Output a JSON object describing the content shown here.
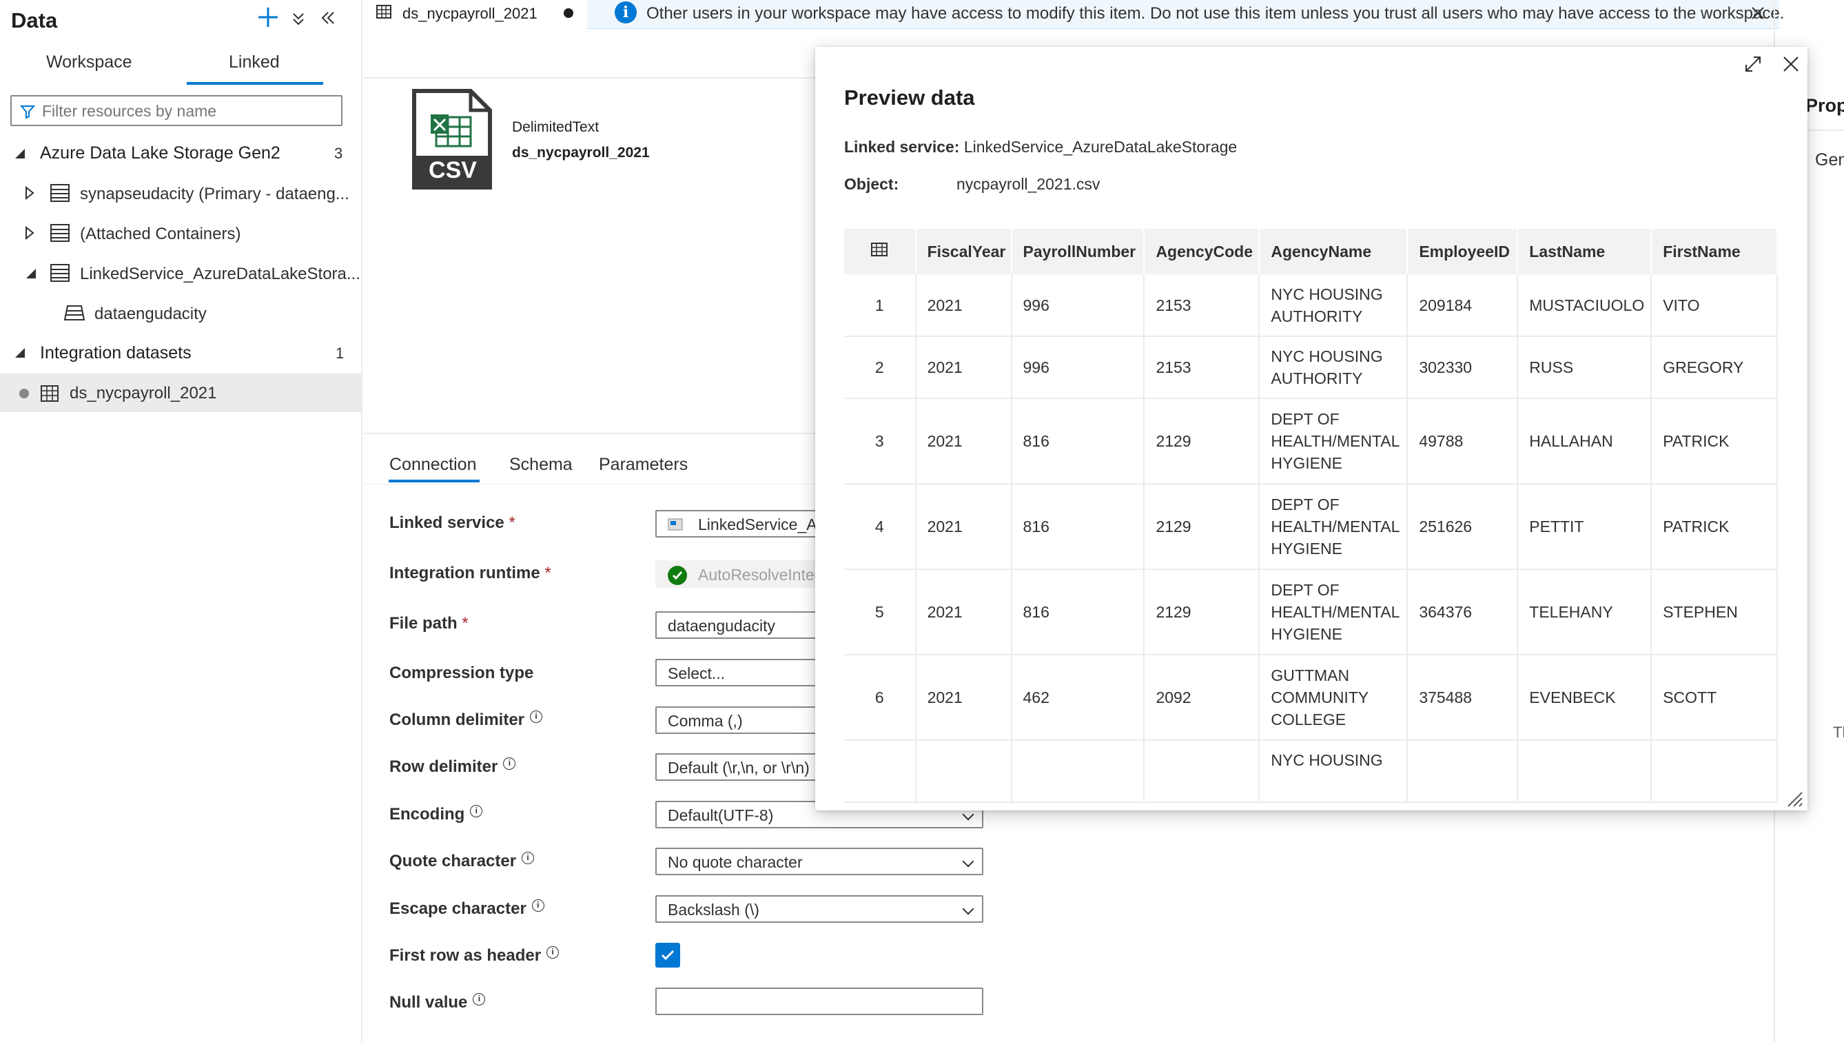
{
  "left_panel": {
    "title": "Data",
    "tabs": [
      "Workspace",
      "Linked"
    ],
    "filter_placeholder": "Filter resources by name",
    "sections": [
      {
        "label": "Azure Data Lake Storage Gen2",
        "count": "3",
        "items": [
          {
            "label": "synapseudacity (Primary - dataeng..."
          },
          {
            "label": "(Attached Containers)"
          },
          {
            "label": "LinkedService_AzureDataLakeStora...",
            "children": [
              {
                "label": "dataengudacity"
              }
            ]
          }
        ]
      },
      {
        "label": "Integration datasets",
        "count": "1",
        "items": [
          {
            "label": "ds_nycpayroll_2021"
          }
        ]
      }
    ]
  },
  "doc_tab": {
    "title": "ds_nycpayroll_2021"
  },
  "banner": {
    "text": "Other users in your workspace may have access to modify this item. Do not use this item unless you trust all users who may have access to the workspace."
  },
  "dataset": {
    "type": "DelimitedText",
    "name": "ds_nycpayroll_2021",
    "icon_label": "CSV"
  },
  "config_tabs": [
    "Connection",
    "Schema",
    "Parameters"
  ],
  "fields": {
    "linked_service": {
      "label": "Linked service",
      "value": "LinkedService_Az"
    },
    "integration_runtime": {
      "label": "Integration runtime",
      "value": "AutoResolveInteg"
    },
    "file_path": {
      "label": "File path",
      "value": "dataengudacity"
    },
    "compression_type": {
      "label": "Compression type",
      "value": "Select..."
    },
    "column_delimiter": {
      "label": "Column delimiter",
      "value": "Comma (,)"
    },
    "row_delimiter": {
      "label": "Row delimiter",
      "value": "Default (\\r,\\n, or \\r\\n)"
    },
    "encoding": {
      "label": "Encoding",
      "value": "Default(UTF-8)"
    },
    "quote_character": {
      "label": "Quote character",
      "value": "No quote character"
    },
    "escape_character": {
      "label": "Escape character",
      "value": "Backslash (\\)"
    },
    "first_row_header": {
      "label": "First row as header",
      "checked": true
    },
    "null_value": {
      "label": "Null value",
      "value": ""
    }
  },
  "right_panel": {
    "title": "Prop",
    "tab": "Gen",
    "extra": "Tl"
  },
  "preview": {
    "title": "Preview data",
    "linked_service_label": "Linked service:",
    "linked_service_value": "LinkedService_AzureDataLakeStorage",
    "object_label": "Object:",
    "object_value": "nycpayroll_2021.csv",
    "columns": [
      "FiscalYear",
      "PayrollNumber",
      "AgencyCode",
      "AgencyName",
      "EmployeeID",
      "LastName",
      "FirstName"
    ],
    "rows": [
      {
        "n": "1",
        "cells": [
          "2021",
          "996",
          "2153",
          "NYC HOUSING AUTHORITY",
          "209184",
          "MUSTACIUOLO",
          "VITO"
        ]
      },
      {
        "n": "2",
        "cells": [
          "2021",
          "996",
          "2153",
          "NYC HOUSING AUTHORITY",
          "302330",
          "RUSS",
          "GREGORY"
        ]
      },
      {
        "n": "3",
        "cells": [
          "2021",
          "816",
          "2129",
          "DEPT OF HEALTH/MENTAL HYGIENE",
          "49788",
          "HALLAHAN",
          "PATRICK"
        ]
      },
      {
        "n": "4",
        "cells": [
          "2021",
          "816",
          "2129",
          "DEPT OF HEALTH/MENTAL HYGIENE",
          "251626",
          "PETTIT",
          "PATRICK"
        ]
      },
      {
        "n": "5",
        "cells": [
          "2021",
          "816",
          "2129",
          "DEPT OF HEALTH/MENTAL HYGIENE",
          "364376",
          "TELEHANY",
          "STEPHEN"
        ]
      },
      {
        "n": "6",
        "cells": [
          "2021",
          "462",
          "2092",
          "GUTTMAN COMMUNITY COLLEGE",
          "375488",
          "EVENBECK",
          "SCOTT"
        ]
      },
      {
        "n": "",
        "cells": [
          "",
          "",
          "",
          "NYC HOUSING",
          "",
          "",
          ""
        ]
      }
    ]
  },
  "colors": {
    "accent": "#0078d4",
    "required": "#a4262c",
    "banner_bg": "#eff6fc",
    "success": "#107c10",
    "excel_green": "#217346"
  }
}
